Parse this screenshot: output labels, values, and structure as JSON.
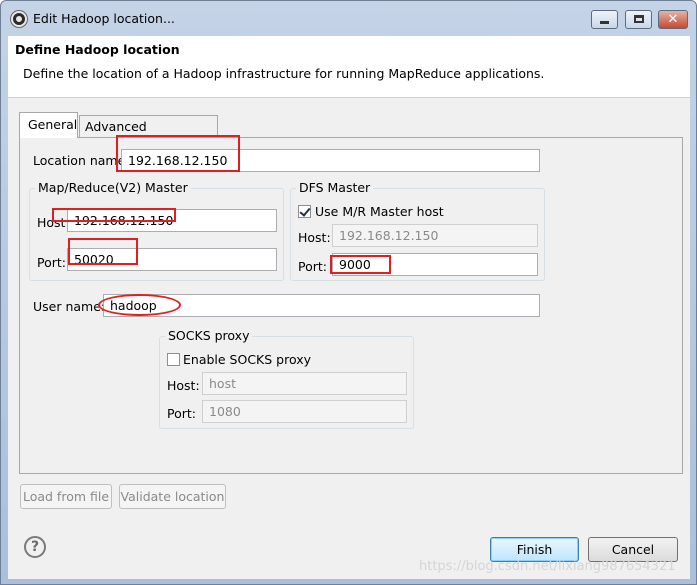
{
  "window": {
    "title": "Edit Hadoop location...",
    "close_glyph": "✕"
  },
  "header": {
    "title": "Define Hadoop location",
    "description": "Define the location of a Hadoop infrastructure for running MapReduce applications."
  },
  "tabs": [
    {
      "label": "General",
      "active": true
    },
    {
      "label": "Advanced parameters",
      "active": false
    }
  ],
  "general": {
    "location_name": {
      "label": "Location name:",
      "value": "192.168.12.150"
    },
    "mr_master": {
      "title": "Map/Reduce(V2) Master",
      "host": {
        "label": "Host:",
        "value": "192.168.12.150"
      },
      "port": {
        "label": "Port:",
        "value": "50020"
      }
    },
    "dfs_master": {
      "title": "DFS Master",
      "use_mr_host": {
        "label": "Use M/R Master host",
        "checked": true
      },
      "host": {
        "label": "Host:",
        "value": "192.168.12.150"
      },
      "port": {
        "label": "Port:",
        "value": "9000"
      }
    },
    "user_name": {
      "label": "User name:",
      "value": "hadoop"
    },
    "socks": {
      "title": "SOCKS proxy",
      "enable": {
        "label": "Enable SOCKS proxy",
        "checked": false
      },
      "host": {
        "label": "Host:",
        "value": "host"
      },
      "port": {
        "label": "Port:",
        "value": "1080"
      }
    }
  },
  "buttons": {
    "load_from_file": "Load from file",
    "validate_location": "Validate location",
    "finish": "Finish",
    "cancel": "Cancel",
    "help_glyph": "?"
  },
  "watermark": "https://blog.csdn.net/lixiang987654321",
  "colors": {
    "annotation": "#e02020",
    "title_gradient_top": "#c4d3e6",
    "default_button": "#bee6fd"
  }
}
